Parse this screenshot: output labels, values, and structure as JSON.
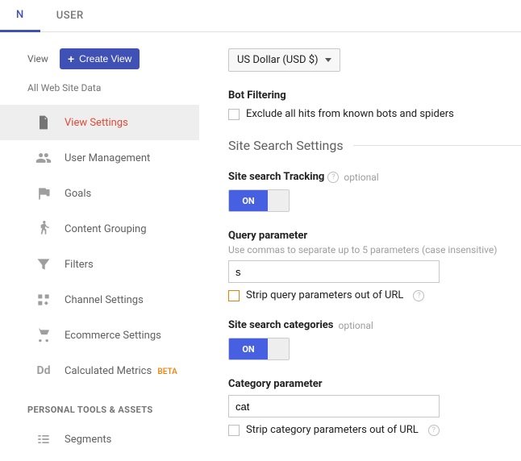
{
  "tabs": {
    "admin": "N",
    "user": "USER"
  },
  "sidebar": {
    "viewLabel": "View",
    "createView": "Create View",
    "allWeb": "All Web Site Data",
    "items": [
      {
        "label": "View Settings"
      },
      {
        "label": "User Management"
      },
      {
        "label": "Goals"
      },
      {
        "label": "Content Grouping"
      },
      {
        "label": "Filters"
      },
      {
        "label": "Channel Settings"
      },
      {
        "label": "Ecommerce Settings"
      },
      {
        "label": "Calculated Metrics",
        "badge": "BETA"
      }
    ],
    "personalSection": "PERSONAL TOOLS & ASSETS",
    "segments": "Segments"
  },
  "main": {
    "currency": "US Dollar (USD $)",
    "botFiltering": {
      "title": "Bot Filtering",
      "checkboxLabel": "Exclude all hits from known bots and spiders"
    },
    "siteSearchHeader": "Site Search Settings",
    "siteSearchTracking": {
      "label": "Site search Tracking",
      "optional": "optional",
      "toggle": "ON"
    },
    "queryParam": {
      "label": "Query parameter",
      "sublabel": "Use commas to separate up to 5 parameters (case insensitive)",
      "value": "s",
      "stripLabel": "Strip query parameters out of URL"
    },
    "siteSearchCategories": {
      "label": "Site search categories",
      "optional": "optional",
      "toggle": "ON"
    },
    "categoryParam": {
      "label": "Category parameter",
      "value": "cat",
      "stripLabel": "Strip category parameters out of URL"
    }
  }
}
